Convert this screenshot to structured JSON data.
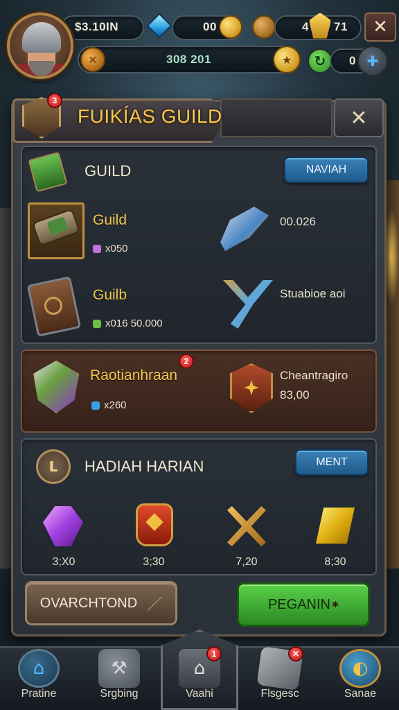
{
  "hud": {
    "resource1": "$3.10IN",
    "resource2": "00",
    "resource3": "4",
    "resource4": "71",
    "xp": "308 201",
    "resource5": "0",
    "close_glyph": "✕"
  },
  "panel": {
    "title": "FUIKÍAS GUILD",
    "emblem_badge": "3",
    "close_glyph": "✕"
  },
  "guild_section": {
    "title": "GUILD",
    "button": "NAVIAH",
    "items": [
      {
        "name": "Guild",
        "sub": "x050",
        "right": "00.026",
        "icon": "scroll-icon"
      },
      {
        "name": "Guilb",
        "sub": "x016 50.000",
        "right": "Stuabioe aoi",
        "icon": "book-icon"
      }
    ],
    "highlight": {
      "name": "Raotianhraan",
      "badge": "2",
      "sub": "x260",
      "right_line1": "Cheantragiro",
      "right_line2": "83,00"
    }
  },
  "daily_section": {
    "title": "HADIAH HARIAN",
    "button": "MENT",
    "rewards": [
      {
        "label": "3;X0",
        "icon": "purple-gem-icon"
      },
      {
        "label": "3;30",
        "icon": "potion-icon"
      },
      {
        "label": "7,20",
        "icon": "crossed-tools-icon"
      },
      {
        "label": "8;30",
        "icon": "gold-bar-icon"
      }
    ]
  },
  "actions": {
    "secondary": "OVARCHTOND",
    "primary": "PEGANIN"
  },
  "nav": [
    {
      "label": "Pratine",
      "icon": "home-icon"
    },
    {
      "label": "Srgbing",
      "icon": "anvil-icon"
    },
    {
      "label": "Vaahi",
      "icon": "tower-icon",
      "badge": "1"
    },
    {
      "label": "Flsgesc",
      "icon": "stone-icon",
      "badge": "✕"
    },
    {
      "label": "Sanae",
      "icon": "globe-icon"
    }
  ]
}
